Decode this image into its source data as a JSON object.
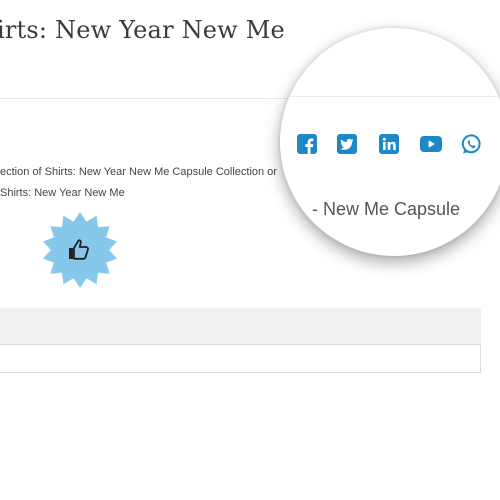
{
  "header": {
    "title": "irts: New Year New Me"
  },
  "description": {
    "line1": "ection of Shirts: New Year New Me Capsule Collection or",
    "line2": "Shirts: New Year New Me"
  },
  "badge": {
    "icon": "thumbs-up-icon",
    "color": "#86c8ec"
  },
  "magnifier": {
    "social_icons": [
      "facebook-icon",
      "twitter-icon",
      "linkedin-icon",
      "youtube-icon",
      "whatsapp-icon"
    ],
    "icon_color": "#1e88c7",
    "text": "New Me Capsule"
  }
}
